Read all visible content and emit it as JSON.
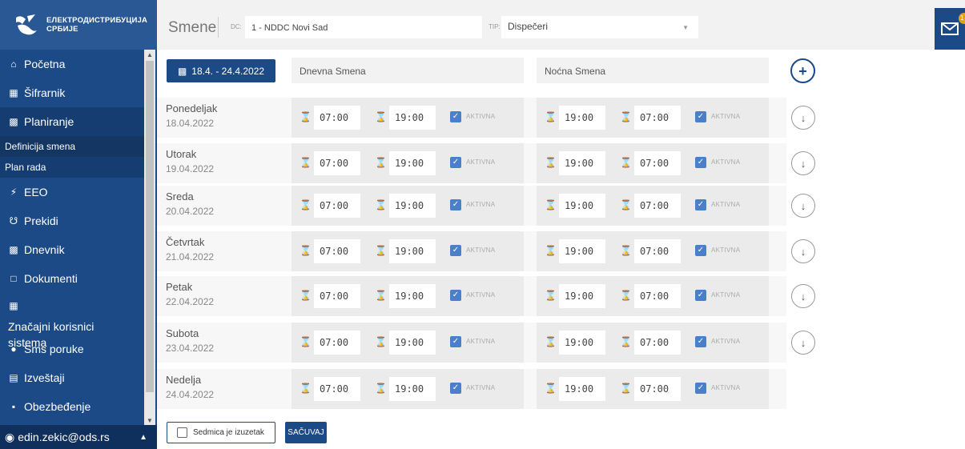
{
  "brand": {
    "line1": "ЕЛЕКТРОДИСТРИБУЦИЈА",
    "line2": "СРБИЈЕ"
  },
  "sidebar": {
    "items": [
      {
        "label": "Početna",
        "icon": "home-icon"
      },
      {
        "label": "Šifrarnik",
        "icon": "table-icon"
      },
      {
        "label": "Planiranje",
        "icon": "calendar-icon"
      },
      {
        "label": "EEO",
        "icon": "bolt-icon"
      },
      {
        "label": "Prekidi",
        "icon": "plug-icon"
      },
      {
        "label": "Dnevnik",
        "icon": "calendar-icon"
      },
      {
        "label": "Dokumenti",
        "icon": "file-icon"
      },
      {
        "label": "Značajni korisnici sistema",
        "icon": "building-icon"
      },
      {
        "label": "Sms poruke",
        "icon": "chat-icon"
      },
      {
        "label": "Izveštaji",
        "icon": "report-icon"
      },
      {
        "label": "Obezbeđenje",
        "icon": "document-icon"
      }
    ],
    "sub_items": [
      "Definicija smena",
      "Plan rada"
    ],
    "user": "edin.zekic@ods.rs"
  },
  "header": {
    "title": "Smene",
    "dc_label": "DC:",
    "dc_value": "1 - NDDC Novi Sad",
    "tip_label": "TIP:",
    "tip_value": "Dispečeri",
    "mail_badge": "1"
  },
  "toolbar": {
    "week_range": "18.4. - 24.4.2022",
    "day_shift": "Dnevna Smena",
    "night_shift": "Noćna Smena"
  },
  "status_label": "AKTIVNA",
  "days": [
    {
      "name": "Ponedeljak",
      "date": "18.04.2022",
      "day_from": "07:00",
      "day_to": "19:00",
      "night_from": "19:00",
      "night_to": "07:00"
    },
    {
      "name": "Utorak",
      "date": "19.04.2022",
      "day_from": "07:00",
      "day_to": "19:00",
      "night_from": "19:00",
      "night_to": "07:00"
    },
    {
      "name": "Sreda",
      "date": "20.04.2022",
      "day_from": "07:00",
      "day_to": "19:00",
      "night_from": "19:00",
      "night_to": "07:00"
    },
    {
      "name": "Četvrtak",
      "date": "21.04.2022",
      "day_from": "07:00",
      "day_to": "19:00",
      "night_from": "19:00",
      "night_to": "07:00"
    },
    {
      "name": "Petak",
      "date": "22.04.2022",
      "day_from": "07:00",
      "day_to": "19:00",
      "night_from": "19:00",
      "night_to": "07:00"
    },
    {
      "name": "Subota",
      "date": "23.04.2022",
      "day_from": "07:00",
      "day_to": "19:00",
      "night_from": "19:00",
      "night_to": "07:00"
    },
    {
      "name": "Nedelja",
      "date": "24.04.2022",
      "day_from": "07:00",
      "day_to": "19:00",
      "night_from": "19:00",
      "night_to": "07:00"
    }
  ],
  "footer": {
    "exception_label": "Sedmica je izuzetak",
    "save_label": "SAČUVAJ"
  }
}
